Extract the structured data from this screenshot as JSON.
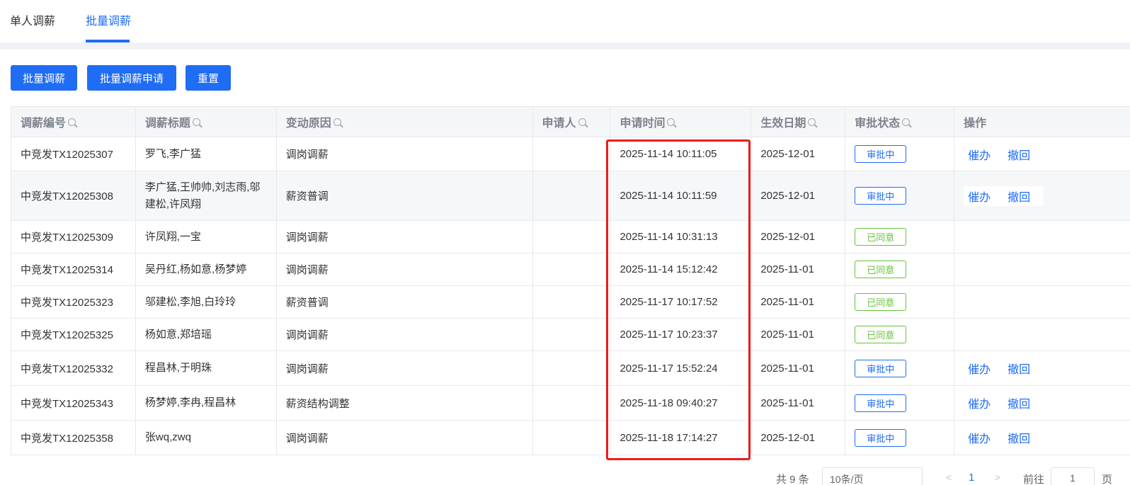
{
  "tabs": [
    {
      "label": "单人调薪",
      "active": false
    },
    {
      "label": "批量调薪",
      "active": true
    }
  ],
  "toolbar": {
    "batch_adjust": "批量调薪",
    "batch_apply": "批量调薪申请",
    "reset": "重置"
  },
  "table": {
    "headers": [
      "调薪编号",
      "调薪标题",
      "变动原因",
      "申请人",
      "申请时间",
      "生效日期",
      "审批状态",
      "操作"
    ],
    "rows": [
      {
        "id": "中竞发TX12025307",
        "title": "罗飞,李广猛",
        "reason": "调岗调薪",
        "applicant": "",
        "apply_time": "2025-11-14 10:11:05",
        "effective": "2025-12-01",
        "status": "审批中",
        "actions": [
          "催办",
          "撤回"
        ]
      },
      {
        "id": "中竞发TX12025308",
        "title": "李广猛,王帅帅,刘志雨,邬建松,许凤翔",
        "reason": "薪资普调",
        "applicant": "",
        "apply_time": "2025-11-14 10:11:59",
        "effective": "2025-12-01",
        "status": "审批中",
        "actions": [
          "催办",
          "撤回"
        ]
      },
      {
        "id": "中竞发TX12025309",
        "title": "许凤翔,一宝",
        "reason": "调岗调薪",
        "applicant": "",
        "apply_time": "2025-11-14 10:31:13",
        "effective": "2025-12-01",
        "status": "已同意",
        "actions": []
      },
      {
        "id": "中竞发TX12025314",
        "title": "吴丹红,杨如意,杨梦婷",
        "reason": "调岗调薪",
        "applicant": "",
        "apply_time": "2025-11-14 15:12:42",
        "effective": "2025-11-01",
        "status": "已同意",
        "actions": []
      },
      {
        "id": "中竞发TX12025323",
        "title": "邬建松,李旭,白玲玲",
        "reason": "薪资普调",
        "applicant": "",
        "apply_time": "2025-11-17 10:17:52",
        "effective": "2025-11-01",
        "status": "已同意",
        "actions": []
      },
      {
        "id": "中竞发TX12025325",
        "title": "杨如意,郑培瑶",
        "reason": "调岗调薪",
        "applicant": "",
        "apply_time": "2025-11-17 10:23:37",
        "effective": "2025-11-01",
        "status": "已同意",
        "actions": []
      },
      {
        "id": "中竞发TX12025332",
        "title": "程昌林,于明珠",
        "reason": "调岗调薪",
        "applicant": "",
        "apply_time": "2025-11-17 15:52:24",
        "effective": "2025-11-01",
        "status": "审批中",
        "actions": [
          "催办",
          "撤回"
        ]
      },
      {
        "id": "中竞发TX12025343",
        "title": "杨梦婷,李冉,程昌林",
        "reason": "薪资结构调整",
        "applicant": "",
        "apply_time": "2025-11-18 09:40:27",
        "effective": "2025-11-01",
        "status": "审批中",
        "actions": [
          "催办",
          "撤回"
        ]
      },
      {
        "id": "中竞发TX12025358",
        "title": "张wq,zwq",
        "reason": "调岗调薪",
        "applicant": "",
        "apply_time": "2025-11-18 17:14:27",
        "effective": "2025-12-01",
        "status": "审批中",
        "actions": [
          "催办",
          "撤回"
        ]
      }
    ]
  },
  "pagination": {
    "total": "共 9 条",
    "page_size": "10条/页",
    "prev": "<",
    "current_page": "1",
    "next": ">",
    "goto_label": "前往",
    "goto_value": "1",
    "goto_unit": "页"
  },
  "colors": {
    "accent": "#1f6cf5",
    "approved": "#67c23a",
    "highlight": "#ee1c1c"
  }
}
